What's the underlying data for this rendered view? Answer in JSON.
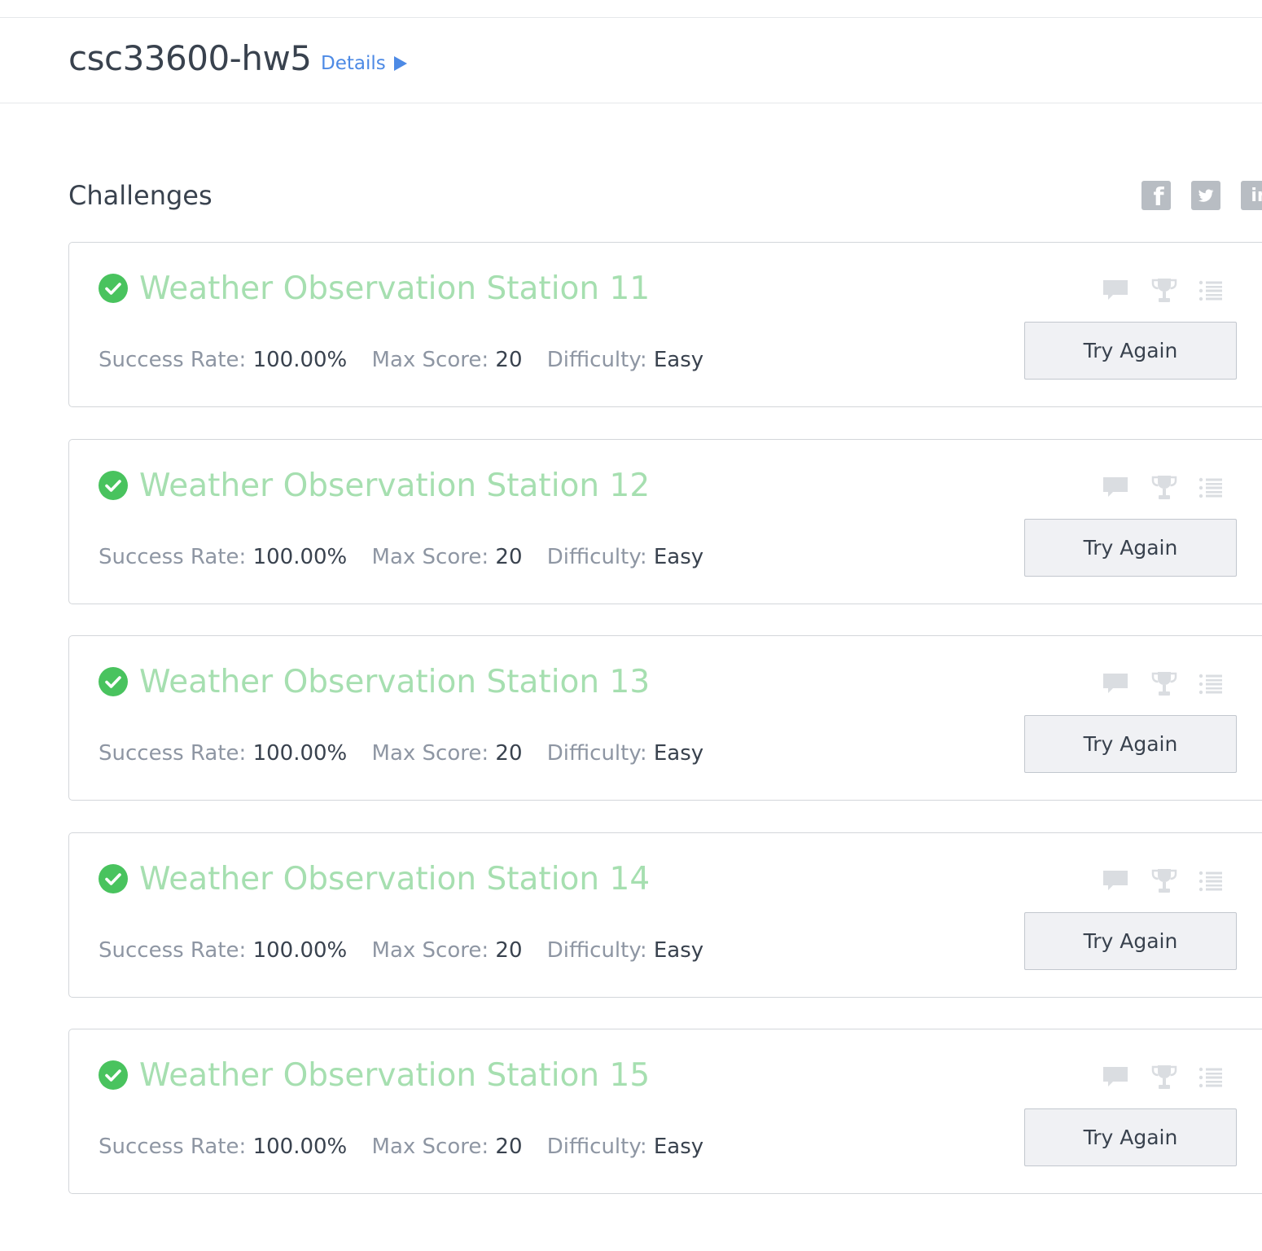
{
  "header": {
    "contest_title": "csc33600-hw5",
    "details_label": "Details"
  },
  "section": {
    "title": "Challenges"
  },
  "social": {
    "facebook_glyph": "f",
    "linkedin_glyph": "in"
  },
  "labels": {
    "success_rate": "Success Rate:",
    "max_score": "Max Score:",
    "difficulty": "Difficulty:",
    "try_again": "Try Again"
  },
  "challenges": [
    {
      "name": "Weather Observation Station 11",
      "success_rate": "100.00%",
      "max_score": "20",
      "difficulty": "Easy",
      "status": "solved"
    },
    {
      "name": "Weather Observation Station 12",
      "success_rate": "100.00%",
      "max_score": "20",
      "difficulty": "Easy",
      "status": "solved"
    },
    {
      "name": "Weather Observation Station 13",
      "success_rate": "100.00%",
      "max_score": "20",
      "difficulty": "Easy",
      "status": "solved"
    },
    {
      "name": "Weather Observation Station 14",
      "success_rate": "100.00%",
      "max_score": "20",
      "difficulty": "Easy",
      "status": "solved"
    },
    {
      "name": "Weather Observation Station 15",
      "success_rate": "100.00%",
      "max_score": "20",
      "difficulty": "Easy",
      "status": "solved"
    }
  ],
  "icons": {
    "check": "check-circle-icon",
    "discussion": "comment-icon",
    "leaderboard": "trophy-icon",
    "submissions": "list-icon",
    "details_arrow": "triangle-right-icon",
    "facebook": "facebook-icon",
    "twitter": "twitter-icon",
    "linkedin": "linkedin-icon"
  },
  "colors": {
    "solved_green": "#49c35e",
    "solved_title": "#a6dfb0",
    "link_blue": "#4d8ae5",
    "icon_gray": "#dadde1"
  }
}
